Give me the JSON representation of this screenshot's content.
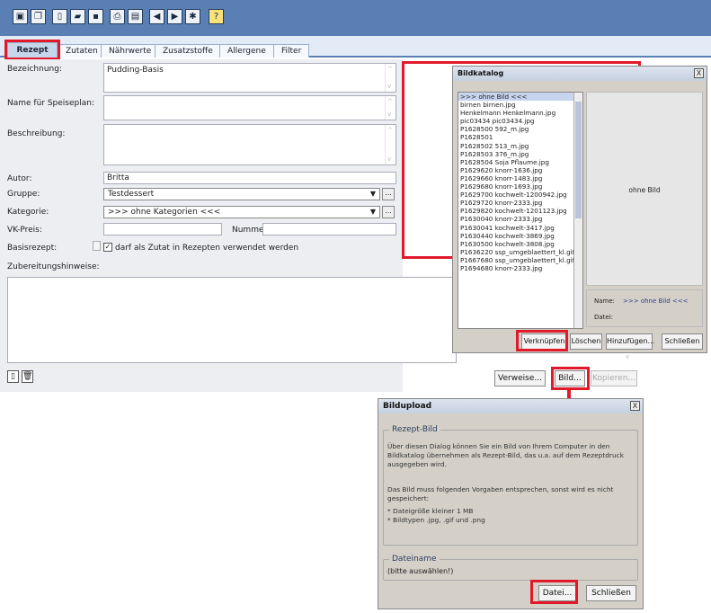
{
  "toolbar": {
    "icons": [
      "window-icon",
      "copy-icon",
      "new-icon",
      "open-icon",
      "save-icon",
      "print-icon",
      "monitor-icon",
      "prev-icon",
      "next-icon",
      "gear-icon",
      "help-icon"
    ],
    "help_label": "?"
  },
  "tabs": [
    "Rezept",
    "Zutaten",
    "Nährwerte",
    "Zusatzstoffe",
    "Allergene",
    "Filter"
  ],
  "form": {
    "bezeichnung_label": "Bezeichnung:",
    "bezeichnung_value": "Pudding-Basis",
    "speiseplan_label": "Name für Speiseplan:",
    "beschreibung_label": "Beschreibung:",
    "autor_label": "Autor:",
    "autor_value": "Britta",
    "gruppe_label": "Gruppe:",
    "gruppe_value": "Testdessert",
    "kategorie_label": "Kategorie:",
    "kategorie_value": ">>> ohne Kategorien <<<",
    "vkpreis_label": "VK-Preis:",
    "nummer_label": "Nummer:",
    "basisrezept_label": "Basisrezept:",
    "basisrezept_check": "darf als Zutat in Rezepten verwendet werden",
    "zubereitung_label": "Zubereitungshinweise:",
    "ellipsis": "...",
    "verweise_btn": "Verweise...",
    "bild_btn": "Bild...",
    "kopieren_btn": "Kopieren..."
  },
  "bildkatalog": {
    "title": "Bildkatalog",
    "close": "X",
    "items": [
      ">>> ohne Bild <<<",
      "birnen birnen.jpg",
      "Henkelmann Henkelmann.jpg",
      "pic03434 pic03434.jpg",
      "P1628500 592_m.jpg",
      "P1628501",
      "P1628502 513_m.jpg",
      "P1628503 376_m.jpg",
      "P1628504 Soja Pflaume.jpg",
      "P1629620 knorr-1636.jpg",
      "P1629660 knorr-1483.jpg",
      "P1629680 knorr-1693.jpg",
      "P1629700 kochwelt-1200942.jpg",
      "P1629720 knorr-2333.jpg",
      "P1629820 kochwelt-1201123.jpg",
      "P1630040 knorr-2333.jpg",
      "P1630041 kochwelt-3417.jpg",
      "P1630440 kochwelt-3869.jpg",
      "P1630500 kochwelt-3808.jpg",
      "P1636220 ssp_umgeblaettert_kl.gif",
      "P1667680 ssp_umgeblaettert_kl.gif",
      "P1694680 knorr-2333.jpg"
    ],
    "preview_text": "ohne Bild",
    "name_label": "Name:",
    "name_value": ">>> ohne Bild <<<",
    "datei_label": "Datei:",
    "btn_verknuepfen": "Verknüpfen",
    "btn_loeschen": "Löschen",
    "btn_hinzufuegen": "Hinzufügen...",
    "btn_schliessen": "Schließen"
  },
  "bildupload": {
    "title": "Bildupload",
    "close": "X",
    "group1": "Rezept-Bild",
    "text1": "Über diesen Dialog können Sie ein Bild von Ihrem Computer in den Bildkatalog übernehmen als Rezept-Bild, das u.a. auf dem Rezeptdruck ausgegeben wird.",
    "text2": "Das Bild muss folgenden Vorgaben entsprechen, sonst wird es nicht gespeichert:",
    "bullet1": "* Dateigröße kleiner 1 MB",
    "bullet2": "* Bildtypen .jpg, .gif und .png",
    "group2": "Dateiname",
    "datei_value": "(bitte auswählen!)",
    "btn_datei": "Datei...",
    "btn_schliessen": "Schließen"
  },
  "colors": {
    "toolbar": "#5a7fb5",
    "highlight": "#e01a2a",
    "tab_active": "#c6d7ec"
  }
}
